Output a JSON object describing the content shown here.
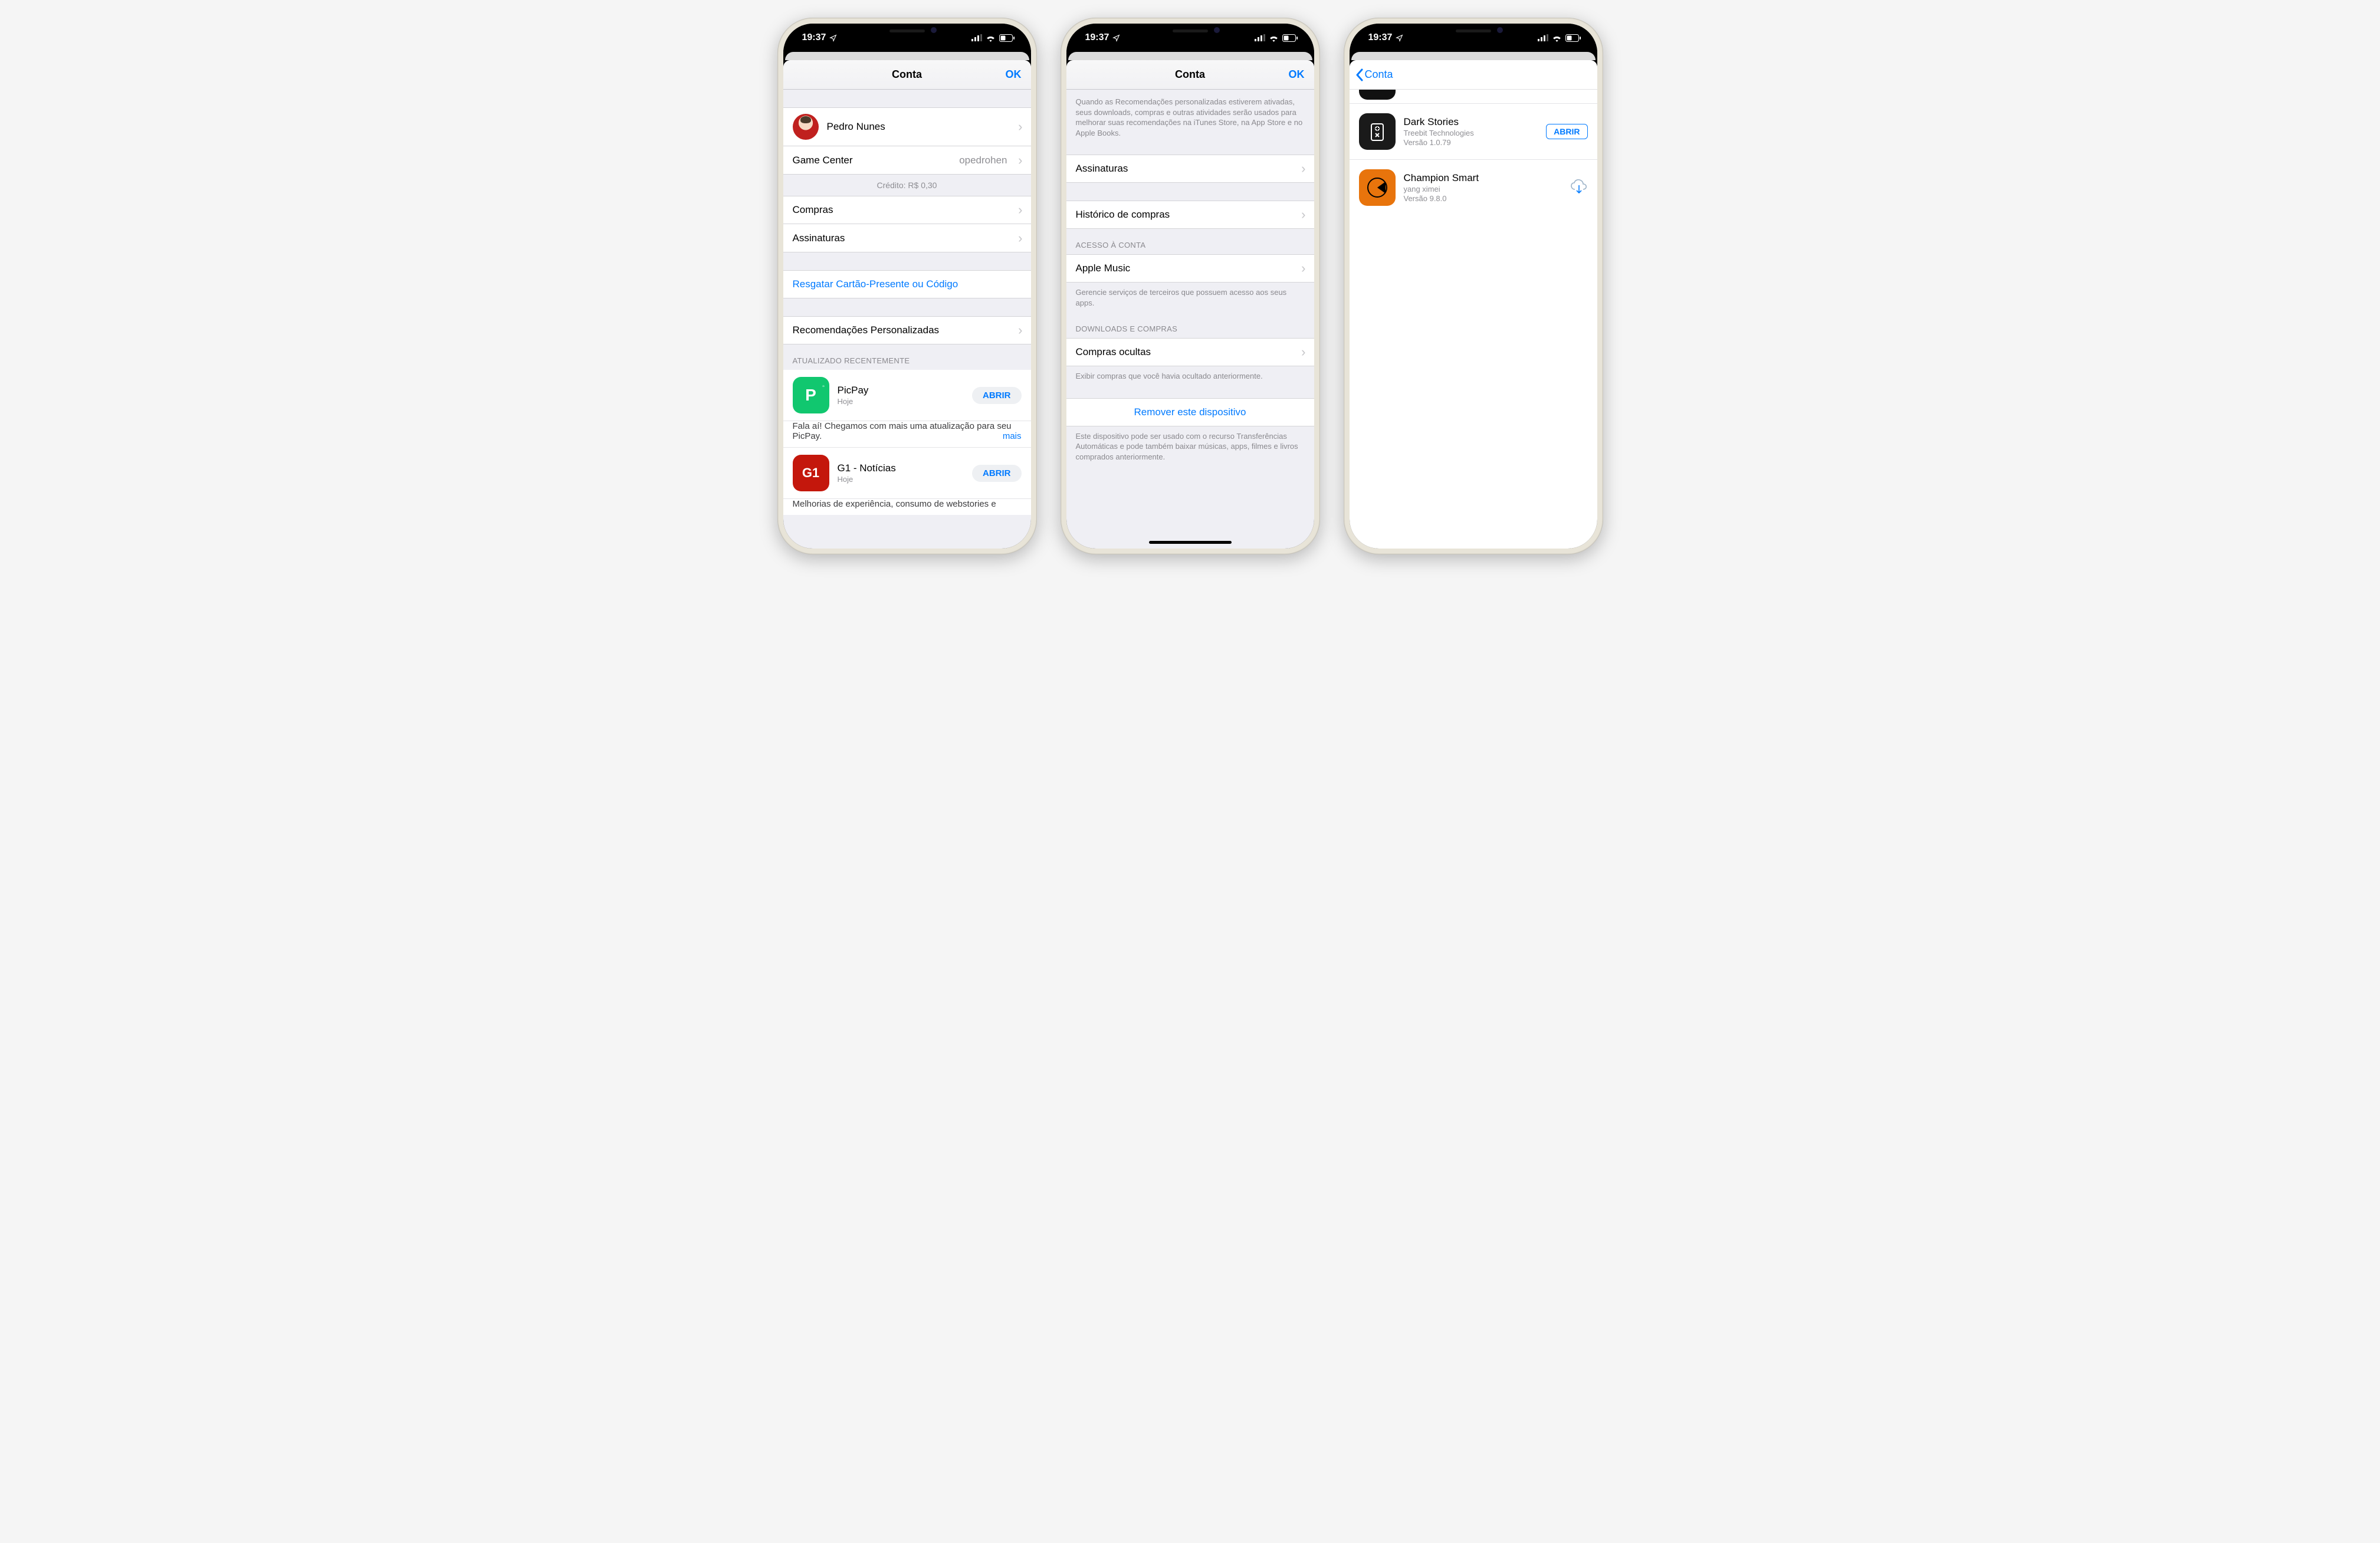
{
  "status": {
    "time": "19:37"
  },
  "colors": {
    "accent": "#007aff"
  },
  "phone1": {
    "nav": {
      "title": "Conta",
      "ok": "OK"
    },
    "profile": {
      "name": "Pedro Nunes"
    },
    "gamecenter": {
      "label": "Game Center",
      "handle": "opedrohen"
    },
    "credit": "Crédito: R$ 0,30",
    "rows": {
      "purchases": "Compras",
      "subs": "Assinaturas",
      "redeem": "Resgatar Cartão-Presente ou Código",
      "recs": "Recomendações Personalizadas"
    },
    "updated_header": "ATUALIZADO RECENTEMENTE",
    "open_label": "ABRIR",
    "more_label": "mais",
    "apps": [
      {
        "name": "PicPay",
        "sub": "Hoje",
        "desc": "Fala aí! Chegamos com mais uma atualização para seu PicPay.",
        "bg": "#11c76f",
        "glyph": "P"
      },
      {
        "name": "G1 - Notícias",
        "sub": "Hoje",
        "desc": "Melhorias de experiência, consumo de webstories e",
        "bg": "#c4170c",
        "glyph": "G1"
      }
    ]
  },
  "phone2": {
    "nav": {
      "title": "Conta",
      "ok": "OK"
    },
    "recs_footer": "Quando as Recomendações personalizadas estiverem ativadas, seus downloads, compras e outras atividades serão usados para melhorar suas recomendações na iTunes Store, na App Store e no Apple Books.",
    "rows": {
      "subs": "Assinaturas",
      "history": "Histórico de compras"
    },
    "access_header": "ACESSO À CONTA",
    "apple_music": "Apple Music",
    "access_footer": "Gerencie serviços de terceiros que possuem acesso aos seus apps.",
    "dl_header": "DOWNLOADS E COMPRAS",
    "hidden": "Compras ocultas",
    "hidden_footer": "Exibir compras que você havia ocultado anteriormente.",
    "remove": "Remover este dispositivo",
    "remove_footer": "Este dispositivo pode ser usado com o recurso Transferências Automáticas e pode também baixar músicas, apps, filmes e livros comprados anteriormente."
  },
  "phone3": {
    "nav": {
      "back": "Conta"
    },
    "open_label": "ABRIR",
    "apps": [
      {
        "name": "Dark Stories",
        "dev": "Treebit Technologies",
        "ver": "Versão 1.0.79",
        "action": "open",
        "bg": "#1a1a1a"
      },
      {
        "name": "Champion Smart",
        "dev": "yang ximei",
        "ver": "Versão 9.8.0",
        "action": "cloud",
        "bg": "#e8740c"
      }
    ]
  }
}
